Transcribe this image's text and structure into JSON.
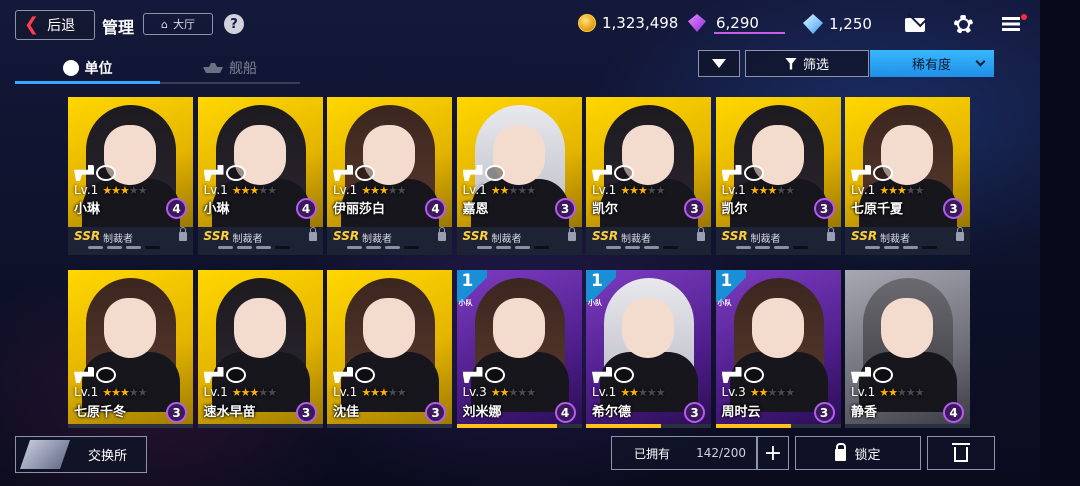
{
  "header": {
    "back_label": "后退",
    "page_title": "管理",
    "hall_label": "大厅",
    "help_symbol": "?"
  },
  "currency": {
    "coins": "1,323,498",
    "gems": "6,290",
    "diamonds": "1,250"
  },
  "icons": [
    "back-chevron-icon",
    "home-icon",
    "help-icon",
    "coin-icon",
    "gem-icon",
    "diamond-icon",
    "mail-icon",
    "gear-icon",
    "menu-icon",
    "filter-icon",
    "lock-icon",
    "trash-icon"
  ],
  "tabs": [
    {
      "label": "单位",
      "active": true
    },
    {
      "label": "舰船",
      "active": false
    }
  ],
  "toolbar": {
    "filter_label": "筛选",
    "sort_label": "稀有度"
  },
  "cards_row1": [
    {
      "name": "小琳",
      "level": "Lv.1",
      "count": "4",
      "rarity": "SSR",
      "role": "制裁者",
      "stars": 3,
      "bg": "yellow",
      "hair": "dark"
    },
    {
      "name": "小琳",
      "level": "Lv.1",
      "count": "4",
      "rarity": "SSR",
      "role": "制裁者",
      "stars": 3,
      "bg": "yellow",
      "hair": "dark"
    },
    {
      "name": "伊丽莎白",
      "level": "Lv.1",
      "count": "4",
      "rarity": "SSR",
      "role": "制裁者",
      "stars": 3,
      "bg": "yellow",
      "hair": "brown"
    },
    {
      "name": "嘉恩",
      "level": "Lv.1",
      "count": "3",
      "rarity": "SSR",
      "role": "制裁者",
      "stars": 2,
      "bg": "yellow",
      "hair": "white"
    },
    {
      "name": "凯尔",
      "level": "Lv.1",
      "count": "3",
      "rarity": "SSR",
      "role": "制裁者",
      "stars": 3,
      "bg": "yellow",
      "hair": "dark"
    },
    {
      "name": "凯尔",
      "level": "Lv.1",
      "count": "3",
      "rarity": "SSR",
      "role": "制裁者",
      "stars": 3,
      "bg": "yellow",
      "hair": "dark"
    },
    {
      "name": "七原千夏",
      "level": "Lv.1",
      "count": "3",
      "rarity": "SSR",
      "role": "制裁者",
      "stars": 3,
      "bg": "yellow",
      "hair": "brown"
    }
  ],
  "cards_row2": [
    {
      "name": "七原千冬",
      "level": "Lv.1",
      "count": "3",
      "stars": 3,
      "bg": "yellow",
      "hair": "brown",
      "rank": "",
      "rank_sub": "",
      "exp": 0
    },
    {
      "name": "速水早苗",
      "level": "Lv.1",
      "count": "3",
      "stars": 3,
      "bg": "yellow",
      "hair": "dark",
      "rank": "",
      "rank_sub": "",
      "exp": 0
    },
    {
      "name": "沈佳",
      "level": "Lv.1",
      "count": "3",
      "stars": 3,
      "bg": "yellow",
      "hair": "brown",
      "rank": "",
      "rank_sub": "",
      "exp": 0
    },
    {
      "name": "刘米娜",
      "level": "Lv.3",
      "count": "4",
      "stars": 2,
      "bg": "purple",
      "hair": "brown",
      "rank": "1",
      "rank_sub": "小队",
      "exp": 0.8
    },
    {
      "name": "希尔德",
      "level": "Lv.1",
      "count": "3",
      "stars": 2,
      "bg": "purple",
      "hair": "white",
      "rank": "1",
      "rank_sub": "小队",
      "exp": 0.6
    },
    {
      "name": "周时云",
      "level": "Lv.3",
      "count": "3",
      "stars": 2,
      "bg": "purple",
      "hair": "brown",
      "rank": "1",
      "rank_sub": "小队",
      "exp": 0.6
    },
    {
      "name": "静香",
      "level": "Lv.1",
      "count": "4",
      "stars": 2,
      "bg": "grey",
      "hair": "grey",
      "rank": "",
      "rank_sub": "",
      "exp": 0
    }
  ],
  "footer": {
    "exchange_label": "交换所",
    "owned_label": "已拥有",
    "owned_value": "142/200",
    "plus_label": "+",
    "lock_label": "锁定"
  }
}
